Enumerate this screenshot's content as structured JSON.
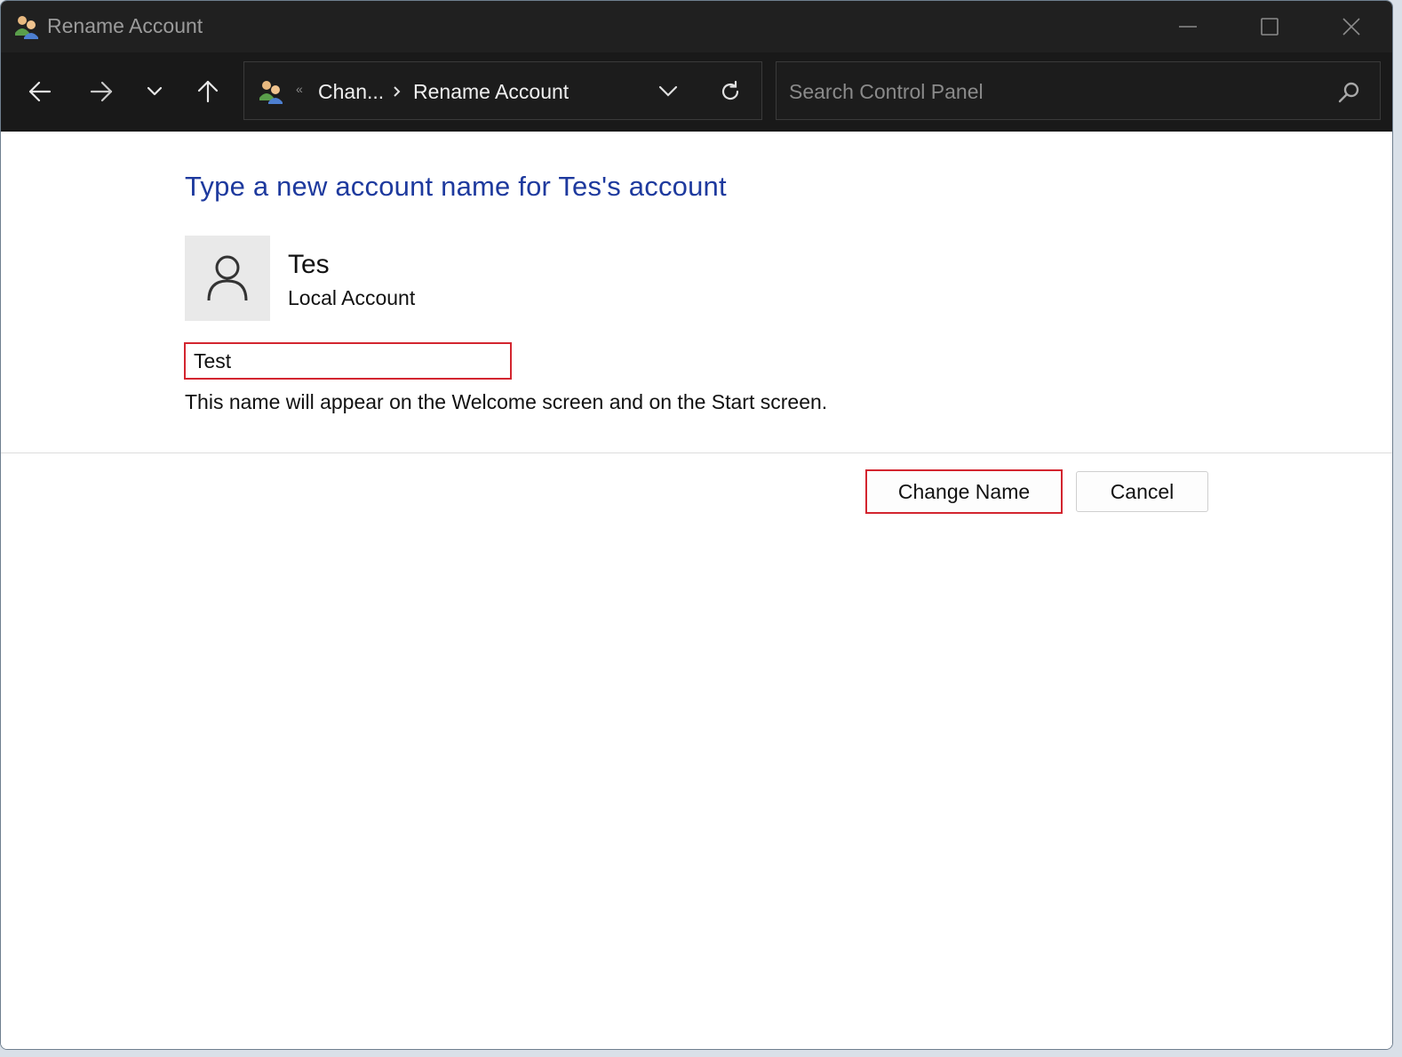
{
  "window": {
    "title": "Rename Account"
  },
  "navigation": {
    "breadcrumb_overflow": "«",
    "breadcrumbs": [
      "Chan...",
      "Rename Account"
    ]
  },
  "search": {
    "placeholder": "Search Control Panel",
    "value": ""
  },
  "main": {
    "heading": "Type a new account name for Tes's account",
    "account": {
      "name": "Tes",
      "type": "Local Account"
    },
    "new_name_value": "Test",
    "hint": "This name will appear on the Welcome screen and on the Start screen."
  },
  "buttons": {
    "change_name": "Change Name",
    "cancel": "Cancel"
  },
  "highlight_color": "#d3252f",
  "heading_color": "#1e3a9e",
  "icons": [
    "users-icon",
    "minimize-icon",
    "maximize-icon",
    "close-icon",
    "back-arrow-icon",
    "forward-arrow-icon",
    "recent-locations-icon",
    "up-arrow-icon",
    "chevron-right-icon",
    "chevron-down-icon",
    "refresh-icon",
    "search-icon",
    "user-avatar-icon"
  ]
}
